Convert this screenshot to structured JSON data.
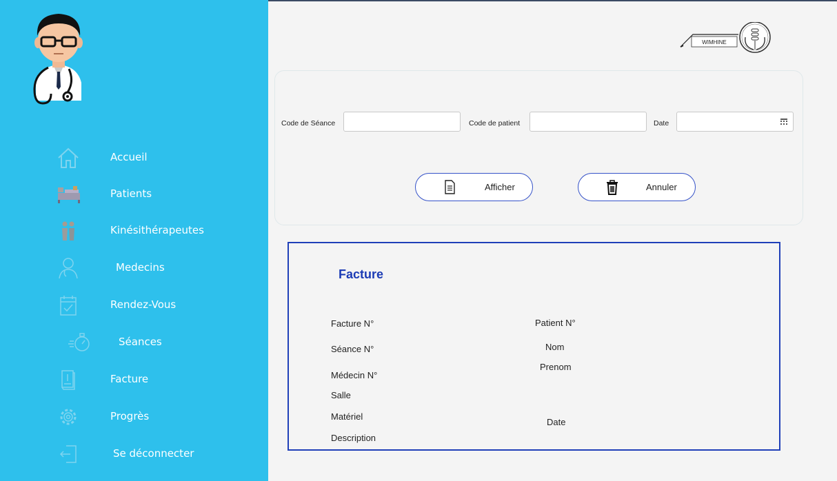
{
  "sidebar": {
    "items": [
      {
        "label": "Accueil",
        "icon": "home-icon"
      },
      {
        "label": "Patients",
        "icon": "hospital-bed-icon"
      },
      {
        "label": "Kinésithérapeutes",
        "icon": "physiotherapists-icon"
      },
      {
        "label": "Medecins",
        "icon": "doctor-icon"
      },
      {
        "label": "Rendez-Vous",
        "icon": "calendar-check-icon"
      },
      {
        "label": "Séances",
        "icon": "stopwatch-icon"
      },
      {
        "label": "Facture",
        "icon": "invoice-icon"
      },
      {
        "label": "Progrès",
        "icon": "gear-icon"
      },
      {
        "label": "Se déconnecter",
        "icon": "logout-icon"
      }
    ]
  },
  "logo": {
    "text": "WIMHINE"
  },
  "search": {
    "session_code_label": "Code de Séance",
    "session_code_value": "",
    "patient_code_label": "Code de patient",
    "patient_code_value": "",
    "date_label": "Date",
    "date_value": "",
    "show_button": "Afficher",
    "cancel_button": "Annuler"
  },
  "invoice": {
    "title": "Facture",
    "invoice_no": "Facture N°",
    "session_no": "Séance N°",
    "doctor_no": "Médecin N°",
    "room": "Salle",
    "equipment": "Matériel",
    "description": "Description",
    "patient_no": "Patient N°",
    "last_name": "Nom",
    "first_name": "Prenom",
    "date": "Date"
  },
  "colors": {
    "sidebar_bg": "#2ec0ec",
    "accent_blue": "#1f3fb8",
    "page_bg": "#f4f4f4"
  }
}
